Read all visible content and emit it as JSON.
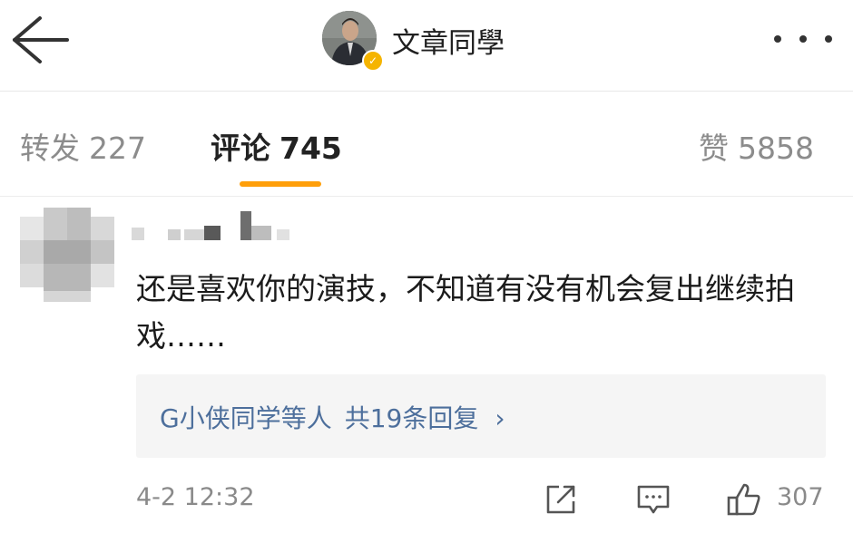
{
  "header": {
    "back_icon": "back-arrow-icon",
    "title": "文章同學",
    "avatar_badge_icon": "verified-badge-icon",
    "more_icon": "more-dots-icon"
  },
  "tabs": [
    {
      "label": "转发",
      "count": "227",
      "active": false
    },
    {
      "label": "评论",
      "count": "745",
      "active": true
    },
    {
      "label": "赞",
      "count": "5858",
      "active": false
    }
  ],
  "accent_color": "#ff9f0a",
  "link_color": "#4d6f9c",
  "comment": {
    "text": "还是喜欢你的演技，不知道有没有机会复出继续拍戏……",
    "reply_summary": {
      "users": "G小侠同学等人",
      "count_text": "共19条回复",
      "chevron": "›"
    },
    "time": "4-2 12:32",
    "like_count": "307",
    "action_icons": [
      "share-icon",
      "comment-icon",
      "thumbs-up-icon"
    ]
  }
}
